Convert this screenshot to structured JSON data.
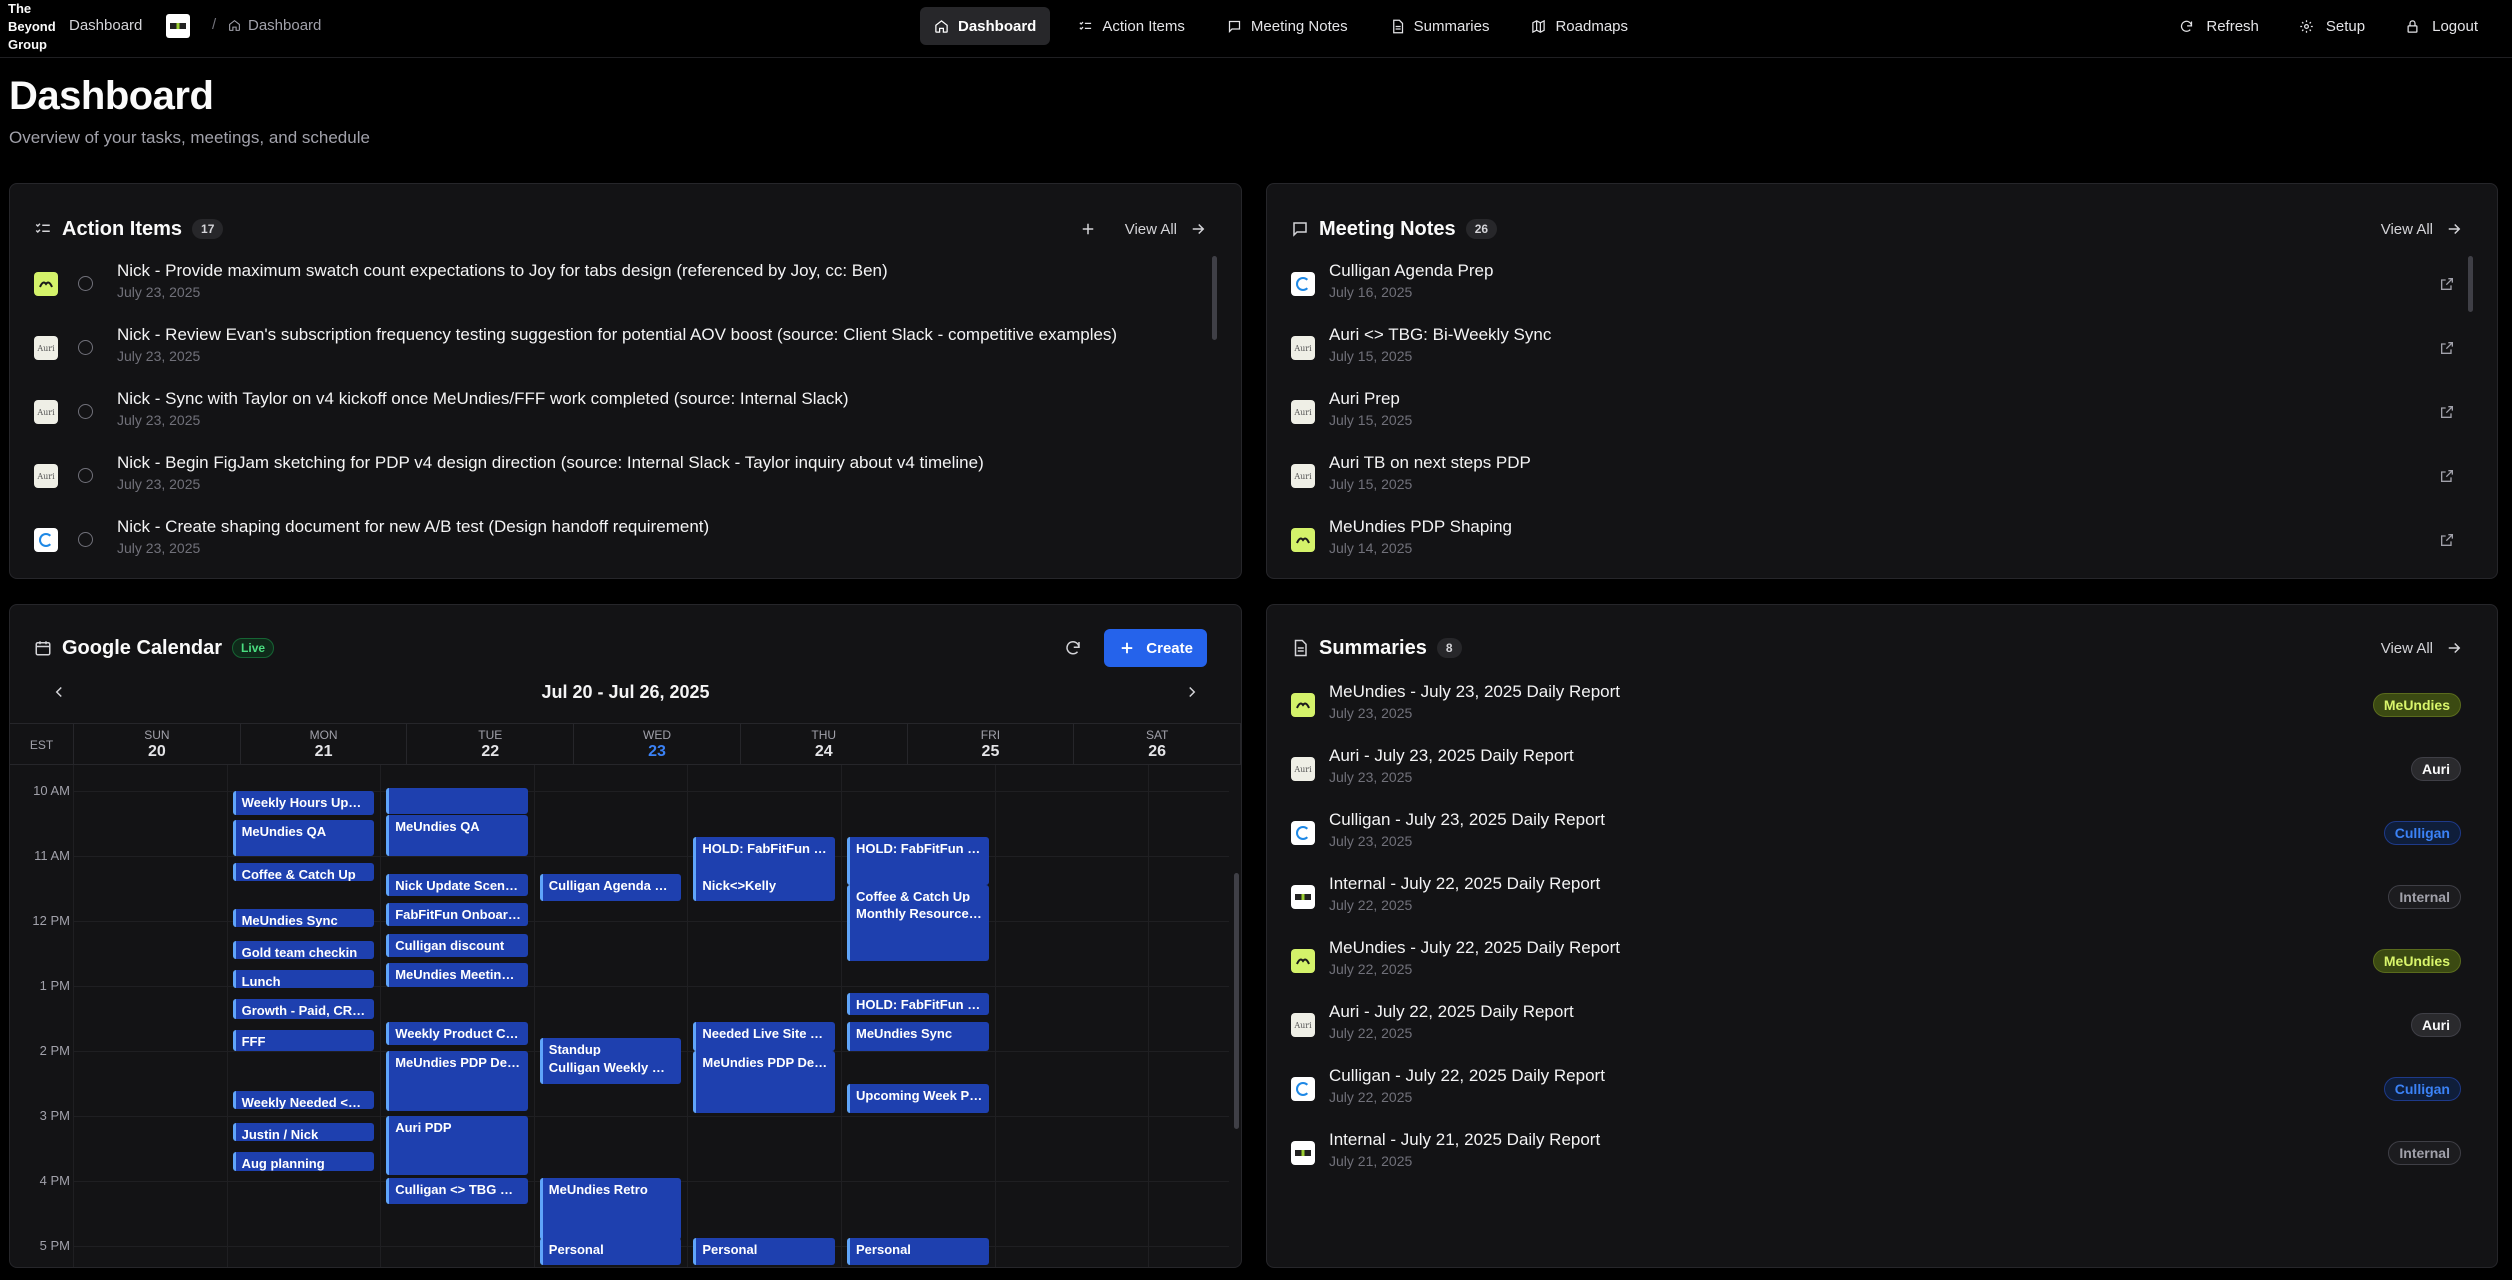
{
  "brand": {
    "line1": "The",
    "line2": "Beyond",
    "line3": "Group"
  },
  "breadcrumb": {
    "root": "Dashboard",
    "sep": "/",
    "current": "Dashboard"
  },
  "nav": {
    "dashboard": "Dashboard",
    "action_items": "Action Items",
    "meeting_notes": "Meeting Notes",
    "summaries": "Summaries",
    "roadmaps": "Roadmaps"
  },
  "actions": {
    "refresh": "Refresh",
    "setup": "Setup",
    "logout": "Logout"
  },
  "page": {
    "title": "Dashboard",
    "subtitle": "Overview of your tasks, meetings, and schedule"
  },
  "action_items": {
    "title": "Action Items",
    "count": "17",
    "view_all": "View All",
    "add_icon": "plus-icon",
    "items": [
      {
        "client": "meundies",
        "title": "Nick - Provide maximum swatch count expectations to Joy for tabs design (referenced by Joy, cc: Ben)",
        "date": "July 23, 2025"
      },
      {
        "client": "auri",
        "title": "Nick - Review Evan's subscription frequency testing suggestion for potential AOV boost (source: Client Slack - competitive examples)",
        "date": "July 23, 2025"
      },
      {
        "client": "auri",
        "title": "Nick - Sync with Taylor on v4 kickoff once MeUndies/FFF work completed (source: Internal Slack)",
        "date": "July 23, 2025"
      },
      {
        "client": "auri",
        "title": "Nick - Begin FigJam sketching for PDP v4 design direction (source: Internal Slack - Taylor inquiry about v4 timeline)",
        "date": "July 23, 2025"
      },
      {
        "client": "culligan",
        "title": "Nick - Create shaping document for new A/B test (Design handoff requirement)",
        "date": "July 23, 2025"
      }
    ]
  },
  "meeting_notes": {
    "title": "Meeting Notes",
    "count": "26",
    "view_all": "View All",
    "items": [
      {
        "client": "culligan",
        "title": "Culligan Agenda Prep",
        "date": "July 16, 2025"
      },
      {
        "client": "auri",
        "title": "Auri <> TBG: Bi-Weekly Sync",
        "date": "July 15, 2025"
      },
      {
        "client": "auri",
        "title": "Auri Prep",
        "date": "July 15, 2025"
      },
      {
        "client": "auri",
        "title": "Auri TB on next steps PDP",
        "date": "July 15, 2025"
      },
      {
        "client": "meundies",
        "title": "MeUndies PDP Shaping",
        "date": "July 14, 2025"
      }
    ]
  },
  "calendar": {
    "title": "Google Calendar",
    "live": "Live",
    "create": "Create",
    "week": "Jul 20 - Jul 26, 2025",
    "tz": "EST",
    "days": [
      {
        "dow": "SUN",
        "num": "20"
      },
      {
        "dow": "MON",
        "num": "21"
      },
      {
        "dow": "TUE",
        "num": "22"
      },
      {
        "dow": "WED",
        "num": "23",
        "today": true
      },
      {
        "dow": "THU",
        "num": "24"
      },
      {
        "dow": "FRI",
        "num": "25"
      },
      {
        "dow": "SAT",
        "num": "26"
      }
    ],
    "hours": [
      "10 AM",
      "11 AM",
      "12 PM",
      "1 PM",
      "2 PM",
      "3 PM",
      "4 PM",
      "5 PM"
    ],
    "events": [
      {
        "day": 1,
        "start": 10.0,
        "end": 10.37,
        "title": "Weekly Hours Update"
      },
      {
        "day": 1,
        "start": 10.45,
        "end": 11.0,
        "title": "MeUndies QA"
      },
      {
        "day": 1,
        "start": 11.1,
        "end": 11.35,
        "title": "Coffee & Catch Up"
      },
      {
        "day": 1,
        "start": 11.82,
        "end": 12.1,
        "title": "MeUndies Sync"
      },
      {
        "day": 1,
        "start": 12.3,
        "end": 12.55,
        "title": "Gold team checkin"
      },
      {
        "day": 1,
        "start": 12.75,
        "end": 13.0,
        "title": "Lunch"
      },
      {
        "day": 1,
        "start": 13.2,
        "end": 13.5,
        "title": "Growth - Paid, CRM, ..."
      },
      {
        "day": 1,
        "start": 13.68,
        "end": 14.0,
        "title": "FFF"
      },
      {
        "day": 1,
        "start": 14.62,
        "end": 14.9,
        "title": "Weekly Needed <> T..."
      },
      {
        "day": 1,
        "start": 15.1,
        "end": 15.38,
        "title": "Justin / Nick"
      },
      {
        "day": 1,
        "start": 15.55,
        "end": 15.85,
        "title": "Aug planning"
      },
      {
        "day": 2,
        "start": 9.95,
        "end": 10.35,
        "title": ""
      },
      {
        "day": 2,
        "start": 10.37,
        "end": 11.0,
        "title": "MeUndies QA"
      },
      {
        "day": 2,
        "start": 11.27,
        "end": 11.62,
        "title": "Nick Update Scent S..."
      },
      {
        "day": 2,
        "start": 11.72,
        "end": 12.08,
        "title": "FabFitFun Onboardin..."
      },
      {
        "day": 2,
        "start": 12.2,
        "end": 12.55,
        "title": "Culligan discount"
      },
      {
        "day": 2,
        "start": 12.65,
        "end": 13.02,
        "title": "MeUndies Meeting N..."
      },
      {
        "day": 2,
        "start": 13.55,
        "end": 13.9,
        "title": "Weekly Product Che..."
      },
      {
        "day": 2,
        "start": 14.0,
        "end": 14.92,
        "title": "MeUndies PDP Desig..."
      },
      {
        "day": 2,
        "start": 15.0,
        "end": 15.9,
        "title": "Auri PDP"
      },
      {
        "day": 2,
        "start": 15.95,
        "end": 16.35,
        "title": "Culligan <> TBG Q3 ..."
      },
      {
        "day": 3,
        "start": 11.27,
        "end": 11.7,
        "title": "Culligan Agenda Prep"
      },
      {
        "day": 3,
        "start": 13.8,
        "end": 14.5,
        "title": "Standup"
      },
      {
        "day": 3,
        "start": 14.07,
        "end": 14.5,
        "title": "Culligan Weekly Mee..."
      },
      {
        "day": 3,
        "start": 15.95,
        "end": 16.9,
        "title": "MeUndies Retro"
      },
      {
        "day": 3,
        "start": 16.88,
        "end": 17.3,
        "title": "Personal"
      },
      {
        "day": 4,
        "start": 10.7,
        "end": 11.45,
        "title": "HOLD: FabFitFun Sta..."
      },
      {
        "day": 4,
        "start": 11.27,
        "end": 11.7,
        "title": "Nick<>Kelly"
      },
      {
        "day": 4,
        "start": 13.55,
        "end": 14.0,
        "title": "Needed Live Site QA ..."
      },
      {
        "day": 4,
        "start": 14.0,
        "end": 14.95,
        "title": "MeUndies PDP Desig..."
      },
      {
        "day": 4,
        "start": 16.88,
        "end": 17.3,
        "title": "Personal"
      },
      {
        "day": 5,
        "start": 10.7,
        "end": 11.45,
        "title": "HOLD: FabFitFun Sta..."
      },
      {
        "day": 5,
        "start": 11.45,
        "end": 12.62,
        "title": "Coffee & Catch Up"
      },
      {
        "day": 5,
        "start": 11.7,
        "end": 12.05,
        "title": "Monthly Resource Pl..."
      },
      {
        "day": 5,
        "start": 13.1,
        "end": 13.45,
        "title": "HOLD: FabFitFun Sta..."
      },
      {
        "day": 5,
        "start": 13.55,
        "end": 14.0,
        "title": "MeUndies Sync"
      },
      {
        "day": 5,
        "start": 14.5,
        "end": 14.95,
        "title": "Upcoming Week Prio..."
      },
      {
        "day": 5,
        "start": 16.88,
        "end": 17.3,
        "title": "Personal"
      }
    ]
  },
  "summaries": {
    "title": "Summaries",
    "count": "8",
    "view_all": "View All",
    "items": [
      {
        "client": "meundies",
        "title": "MeUndies - July 23, 2025 Daily Report",
        "date": "July 23, 2025",
        "tag": "MeUndies"
      },
      {
        "client": "auri",
        "title": "Auri - July 23, 2025 Daily Report",
        "date": "July 23, 2025",
        "tag": "Auri"
      },
      {
        "client": "culligan",
        "title": "Culligan - July 23, 2025 Daily Report",
        "date": "July 23, 2025",
        "tag": "Culligan"
      },
      {
        "client": "internal",
        "title": "Internal - July 22, 2025 Daily Report",
        "date": "July 22, 2025",
        "tag": "Internal"
      },
      {
        "client": "meundies",
        "title": "MeUndies - July 22, 2025 Daily Report",
        "date": "July 22, 2025",
        "tag": "MeUndies"
      },
      {
        "client": "auri",
        "title": "Auri - July 22, 2025 Daily Report",
        "date": "July 22, 2025",
        "tag": "Auri"
      },
      {
        "client": "culligan",
        "title": "Culligan - July 22, 2025 Daily Report",
        "date": "July 22, 2025",
        "tag": "Culligan"
      },
      {
        "client": "internal",
        "title": "Internal - July 21, 2025 Daily Report",
        "date": "July 21, 2025",
        "tag": "Internal"
      }
    ]
  },
  "logos": {
    "auri": "Auri"
  }
}
